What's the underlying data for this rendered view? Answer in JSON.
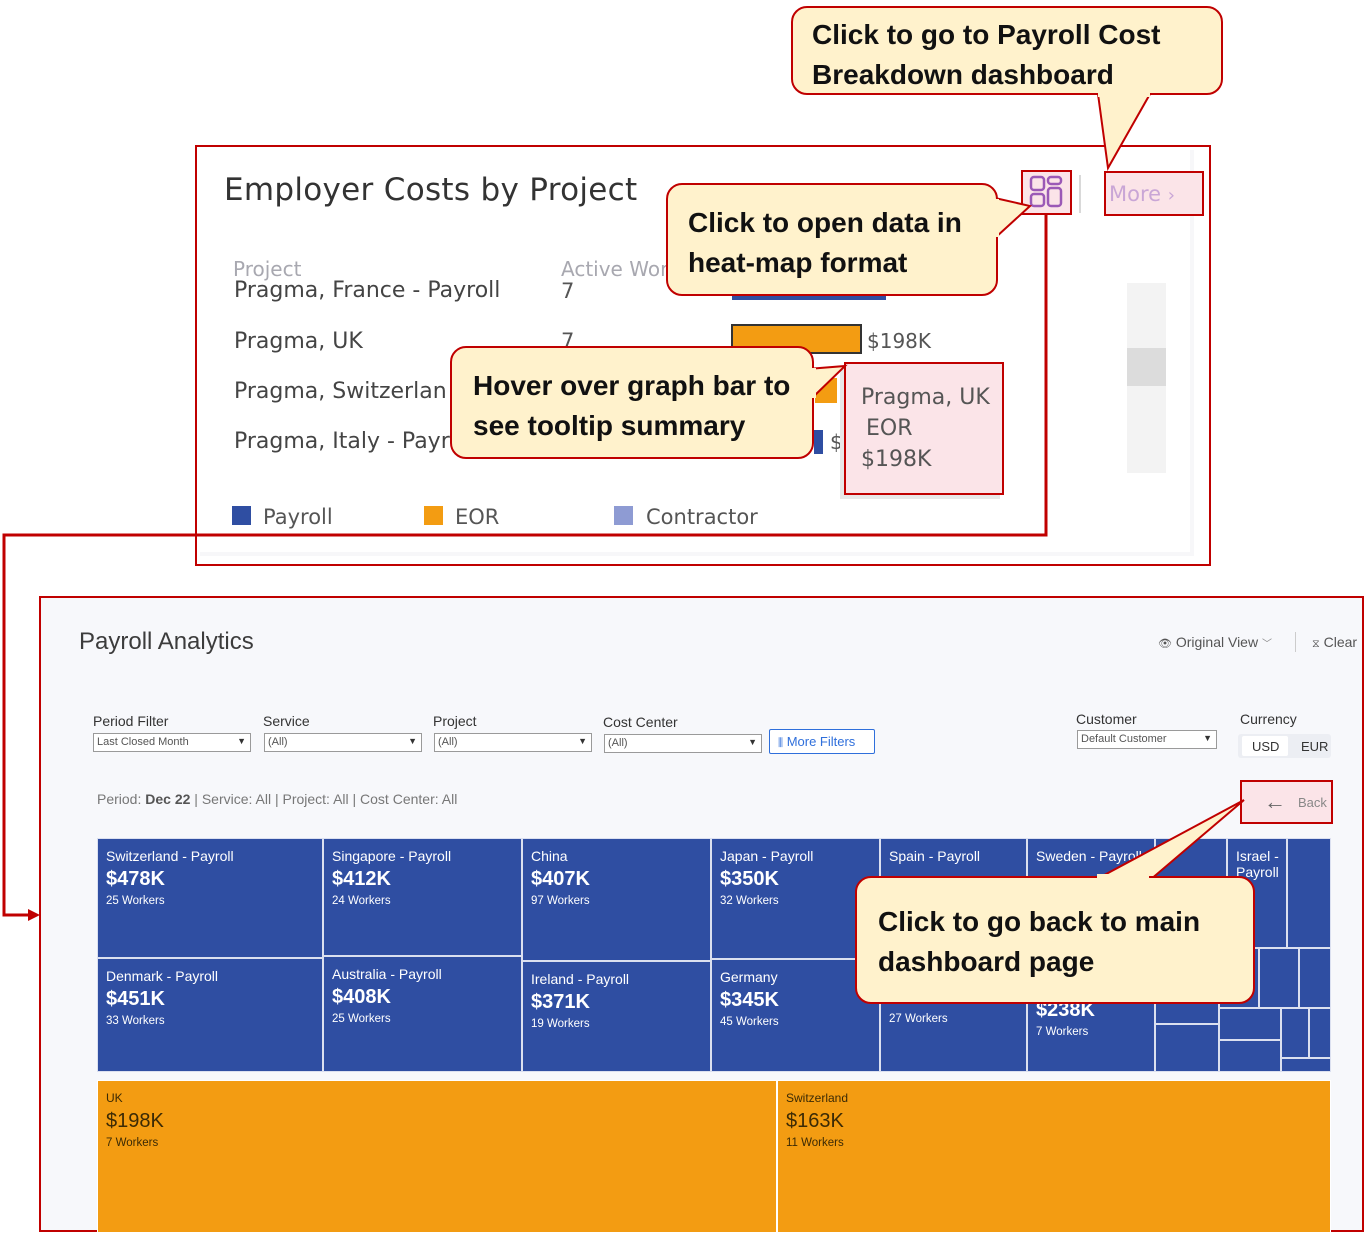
{
  "top_widget": {
    "title": "Employer Costs by Project",
    "column_project": "Project",
    "column_active_workers": "Active Wor",
    "rows": [
      {
        "project": "Pragma, France - Payroll",
        "workers": "7"
      },
      {
        "project": "Pragma, UK",
        "workers": "7",
        "value": "$198K"
      },
      {
        "project": "Pragma, Switzerlan",
        "workers": ""
      },
      {
        "project": "Pragma, Italy - Payr",
        "workers": ""
      }
    ],
    "legend": [
      "Payroll",
      "EOR",
      "Contractor"
    ],
    "colors": {
      "payroll": "#2f4ea2",
      "eor": "#f39c12",
      "contractor": "#8e9bd3"
    },
    "more_label": "More",
    "heatmap_icon": "grid-layout-icon",
    "tooltip": {
      "project": "Pragma, UK",
      "type": "EOR",
      "value": "$198K"
    }
  },
  "callouts": {
    "more": "Click to go to Payroll Cost Breakdown dashboard",
    "heatmap": "Click to open data in heat-map format",
    "hover": "Hover over graph bar to see tooltip summary",
    "back": "Click to go back to main dashboard page"
  },
  "dashboard": {
    "title": "Payroll Analytics",
    "view_label": "Original View",
    "clear_label": "Clear",
    "filters": [
      {
        "label": "Period Filter",
        "value": "Last Closed Month"
      },
      {
        "label": "Service",
        "value": "(All)"
      },
      {
        "label": "Project",
        "value": "(All)"
      },
      {
        "label": "Cost Center",
        "value": "(All)"
      }
    ],
    "more_filters": "More Filters",
    "customer": {
      "label": "Customer",
      "value": "Default Customer"
    },
    "currency": {
      "label": "Currency",
      "options": [
        "USD",
        "EUR"
      ],
      "selected": "USD"
    },
    "period_line": {
      "prefix": "Period: ",
      "period": "Dec 22",
      "rest": " | Service: All | Project: All | Cost Center: All"
    },
    "back_label": "Back",
    "tiles": [
      {
        "name": "Switzerland - Payroll",
        "value": "$478K",
        "workers": "25 Workers"
      },
      {
        "name": "Singapore - Payroll",
        "value": "$412K",
        "workers": "24 Workers"
      },
      {
        "name": "China",
        "value": "$407K",
        "workers": "97 Workers"
      },
      {
        "name": "Japan - Payroll",
        "value": "$350K",
        "workers": "32 Workers"
      },
      {
        "name": "Spain - Payroll",
        "value": "",
        "workers": ""
      },
      {
        "name": "Sweden - Payroll",
        "value": "",
        "workers": ""
      },
      {
        "name": "Israel - Payroll",
        "value": "",
        "workers": ""
      },
      {
        "name": "Denmark - Payroll",
        "value": "$451K",
        "workers": "33 Workers"
      },
      {
        "name": "Australia - Payroll",
        "value": "$408K",
        "workers": "25 Workers"
      },
      {
        "name": "Ireland - Payroll",
        "value": "$371K",
        "workers": "19 Workers"
      },
      {
        "name": "Germany",
        "value": "$345K",
        "workers": "45 Workers"
      },
      {
        "name": "",
        "value": "",
        "workers": "27 Workers"
      },
      {
        "name": "",
        "value": "$238K",
        "workers": "7 Workers"
      },
      {
        "name": "UK",
        "value": "$198K",
        "workers": "7 Workers"
      },
      {
        "name": "Switzerland",
        "value": "$163K",
        "workers": "11 Workers"
      }
    ]
  }
}
